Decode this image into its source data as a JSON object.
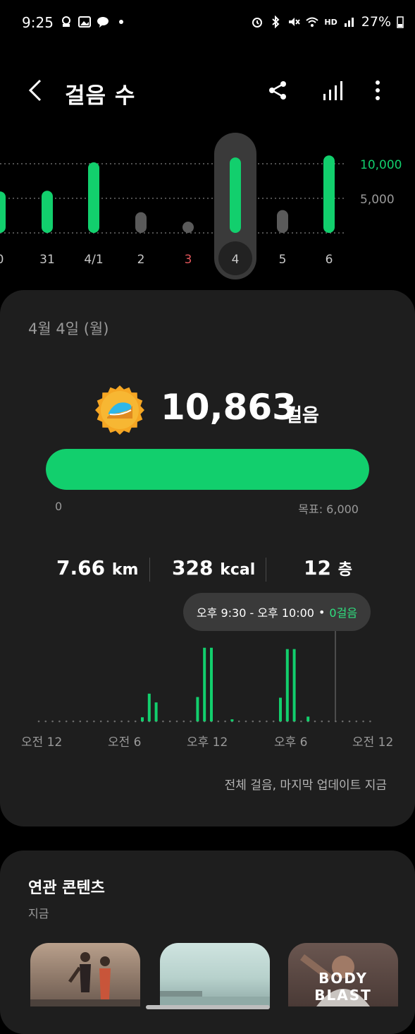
{
  "status_bar": {
    "time": "9:25",
    "battery": "27%",
    "hd_label": "HD"
  },
  "header": {
    "title": "걸음 수"
  },
  "daily_chart": {
    "days": [
      "0",
      "31",
      "4/1",
      "2",
      "3",
      "4",
      "5",
      "6"
    ],
    "values": [
      6000,
      6100,
      10200,
      3000,
      600,
      10900,
      3300,
      11200
    ],
    "goal_met": [
      true,
      true,
      true,
      false,
      false,
      true,
      false,
      true
    ],
    "selected_index": 5,
    "holiday_index": 4,
    "ref_lines": [
      "10,000",
      "5,000"
    ],
    "ref_values": [
      10000,
      5000
    ]
  },
  "summary": {
    "date": "4월 4일 (월)",
    "steps": "10,863",
    "steps_unit": "걸음",
    "progress_min": "0",
    "progress_goal": "목표: 6,000",
    "progress_fraction": 1.0,
    "distance_value": "7.66",
    "distance_unit": "km",
    "calories_value": "328",
    "calories_unit": "kcal",
    "floors_value": "12",
    "floors_unit": "층",
    "tooltip_time": "오후 9:30 - 오후 10:00",
    "tooltip_dot": "•",
    "tooltip_steps": "0걸음",
    "hourly_labels": [
      "오전 12",
      "오전 6",
      "오후 12",
      "오후 6",
      "오전 12"
    ],
    "hourly_values": [
      0,
      0,
      0,
      0,
      0,
      0,
      0,
      0,
      0,
      0,
      0,
      0,
      0,
      0,
      0,
      0,
      0,
      0,
      0,
      0,
      0,
      0,
      0,
      0,
      0,
      0,
      0,
      0,
      0,
      0,
      0,
      0,
      0,
      0,
      0,
      0,
      0,
      0,
      0,
      0,
      0,
      0,
      0,
      0,
      0,
      0,
      0,
      0,
      0,
      0,
      0,
      0,
      0,
      0,
      0,
      0,
      0,
      0,
      0,
      0,
      0,
      0,
      0,
      0,
      0,
      0,
      0,
      0,
      0,
      0,
      0,
      0,
      0,
      0,
      0,
      0,
      0,
      0,
      0,
      0,
      0,
      0,
      0,
      0,
      0,
      0,
      0,
      0,
      0,
      0,
      0,
      0,
      0,
      0,
      0,
      0
    ],
    "hourly_bars": [
      {
        "slot": 15,
        "value": 120
      },
      {
        "slot": 16,
        "value": 820
      },
      {
        "slot": 17,
        "value": 560
      },
      {
        "slot": 23,
        "value": 720
      },
      {
        "slot": 24,
        "value": 2180
      },
      {
        "slot": 25,
        "value": 2180
      },
      {
        "slot": 28,
        "value": 60
      },
      {
        "slot": 35,
        "value": 700
      },
      {
        "slot": 36,
        "value": 2140
      },
      {
        "slot": 37,
        "value": 2140
      },
      {
        "slot": 39,
        "value": 140
      }
    ],
    "hourly_max": 2300,
    "update_note": "전체 걸음, 마지막 업데이트 지금"
  },
  "related": {
    "title": "연관 콘텐츠",
    "subtitle": "지금",
    "thumb_3_text": "BODY BLAST"
  },
  "colors": {
    "accent": "#12cf6d",
    "inactive": "#5a5a5a",
    "holiday": "#e0565b",
    "card": "#1e1e1e"
  }
}
